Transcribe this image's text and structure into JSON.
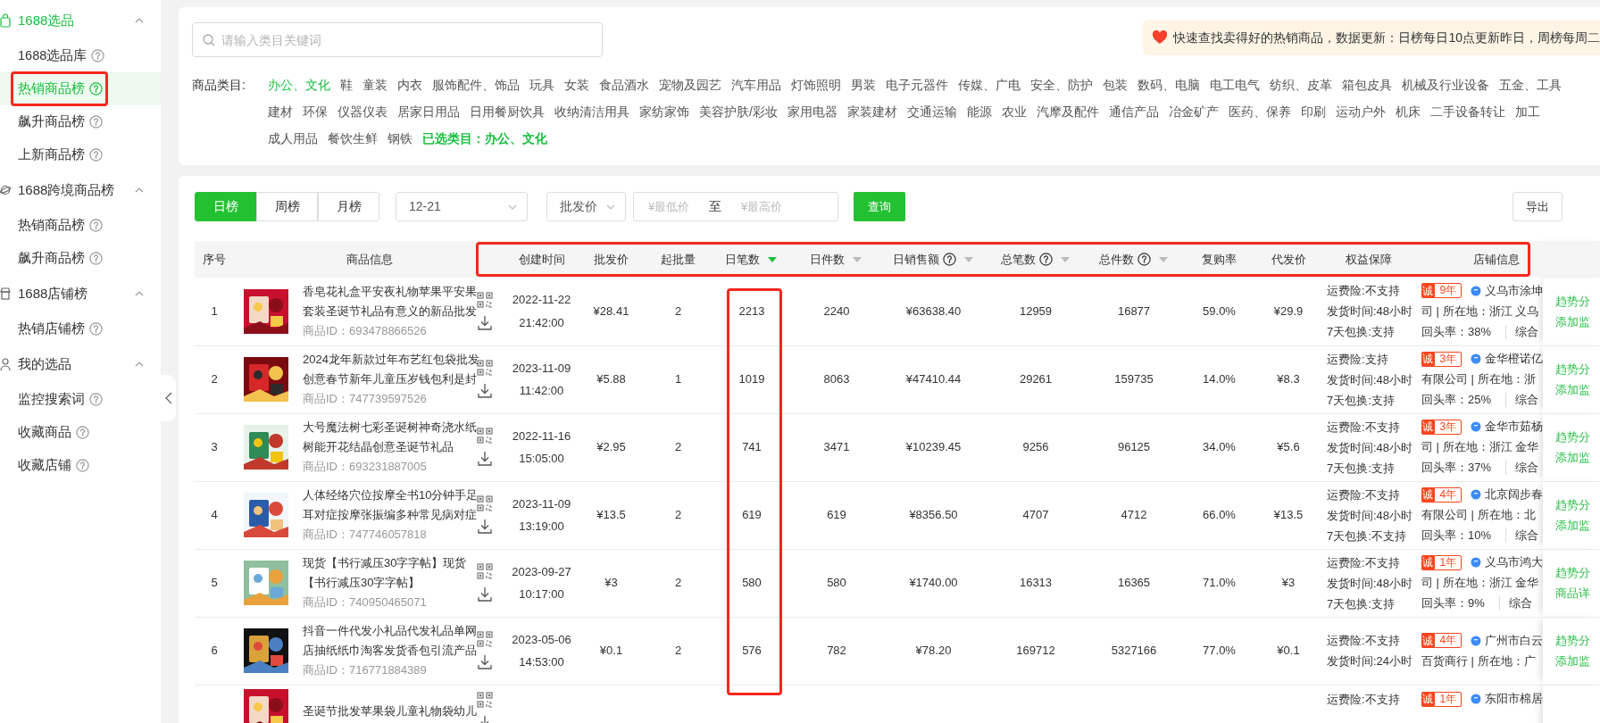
{
  "sidebar": {
    "groups": [
      {
        "title": "1688选品",
        "expanded": true,
        "items": [
          {
            "label": "1688选品库",
            "selected": false,
            "outlined": false
          },
          {
            "label": "热销商品榜",
            "selected": true,
            "outlined": true
          },
          {
            "label": "飙升商品榜",
            "selected": false,
            "outlined": false
          },
          {
            "label": "上新商品榜",
            "selected": false,
            "outlined": false
          }
        ]
      },
      {
        "title": "1688跨境商品榜",
        "expanded": true,
        "items": [
          {
            "label": "热销商品榜",
            "selected": false,
            "outlined": false
          },
          {
            "label": "飙升商品榜",
            "selected": false,
            "outlined": false
          }
        ]
      },
      {
        "title": "1688店铺榜",
        "expanded": true,
        "items": [
          {
            "label": "热销店铺榜",
            "selected": false,
            "outlined": false
          }
        ]
      },
      {
        "title": "我的选品",
        "expanded": true,
        "items": [
          {
            "label": "监控搜索词",
            "selected": false,
            "outlined": false
          },
          {
            "label": "收藏商品",
            "selected": false,
            "outlined": false
          },
          {
            "label": "收藏店铺",
            "selected": false,
            "outlined": false
          }
        ]
      }
    ]
  },
  "filters": {
    "search": {
      "placeholder": "请输入类目关键词"
    },
    "notice": "快速查找卖得好的热销商品，数据更新：日榜每日10点更新昨日，周榜每周二",
    "category_label": "商品类目:",
    "category_rows": [
      [
        {
          "label": "办公、文化",
          "selected": true
        },
        {
          "label": "鞋",
          "selected": false
        },
        {
          "label": "童装",
          "selected": false
        },
        {
          "label": "内衣",
          "selected": false
        },
        {
          "label": "服饰配件、饰品",
          "selected": false
        },
        {
          "label": "玩具",
          "selected": false
        },
        {
          "label": "女装",
          "selected": false
        },
        {
          "label": "食品酒水",
          "selected": false
        },
        {
          "label": "宠物及园艺",
          "selected": false
        },
        {
          "label": "汽车用品",
          "selected": false
        },
        {
          "label": "灯饰照明",
          "selected": false
        },
        {
          "label": "男装",
          "selected": false
        },
        {
          "label": "电子元器件",
          "selected": false
        },
        {
          "label": "传媒、广电",
          "selected": false
        },
        {
          "label": "安全、防护",
          "selected": false
        },
        {
          "label": "包装",
          "selected": false
        },
        {
          "label": "数码、电脑",
          "selected": false
        },
        {
          "label": "电工电气",
          "selected": false
        },
        {
          "label": "纺织、皮革",
          "selected": false
        },
        {
          "label": "箱包皮具",
          "selected": false
        },
        {
          "label": "机械及行业设备",
          "selected": false
        },
        {
          "label": "五金、工具",
          "selected": false
        }
      ],
      [
        {
          "label": "建材",
          "selected": false
        },
        {
          "label": "环保",
          "selected": false
        },
        {
          "label": "仪器仪表",
          "selected": false
        },
        {
          "label": "居家日用品",
          "selected": false
        },
        {
          "label": "日用餐厨饮具",
          "selected": false
        },
        {
          "label": "收纳清洁用具",
          "selected": false
        },
        {
          "label": "家纺家饰",
          "selected": false
        },
        {
          "label": "美容护肤/彩妆",
          "selected": false
        },
        {
          "label": "家用电器",
          "selected": false
        },
        {
          "label": "家装建材",
          "selected": false
        },
        {
          "label": "交通运输",
          "selected": false
        },
        {
          "label": "能源",
          "selected": false
        },
        {
          "label": "农业",
          "selected": false
        },
        {
          "label": "汽摩及配件",
          "selected": false
        },
        {
          "label": "通信产品",
          "selected": false
        },
        {
          "label": "冶金矿产",
          "selected": false
        },
        {
          "label": "医药、保养",
          "selected": false
        },
        {
          "label": "印刷",
          "selected": false
        },
        {
          "label": "运动户外",
          "selected": false
        },
        {
          "label": "机床",
          "selected": false
        },
        {
          "label": "二手设备转让",
          "selected": false
        },
        {
          "label": "加工",
          "selected": false
        }
      ],
      [
        {
          "label": "成人用品",
          "selected": false
        },
        {
          "label": "餐饮生鲜",
          "selected": false
        },
        {
          "label": "钢铁",
          "selected": false
        }
      ]
    ],
    "selected_summary": "已选类目：办公、文化"
  },
  "toolbar": {
    "periods": [
      {
        "label": "日榜",
        "selected": true
      },
      {
        "label": "周榜",
        "selected": false
      },
      {
        "label": "月榜",
        "selected": false
      }
    ],
    "date": "12-21",
    "price_type": "批发价",
    "min_price": {
      "placeholder": "¥最低价"
    },
    "range_sep": "至",
    "max_price": {
      "placeholder": "¥最高价"
    },
    "query": "查询",
    "export": "导出"
  },
  "table": {
    "columns": [
      {
        "label": "序号",
        "kind": "plain",
        "outlined": false,
        "column_outlined": false
      },
      {
        "label": "商品信息",
        "kind": "plain",
        "outlined": false,
        "column_outlined": false
      },
      {
        "label": "创建时间",
        "kind": "plain",
        "outlined": true,
        "column_outlined": false
      },
      {
        "label": "批发价",
        "kind": "plain",
        "outlined": true,
        "column_outlined": false
      },
      {
        "label": "起批量",
        "kind": "plain",
        "outlined": true,
        "column_outlined": false
      },
      {
        "label": "日笔数",
        "kind": "sorted",
        "outlined": true,
        "column_outlined": true
      },
      {
        "label": "日件数",
        "kind": "sortable",
        "outlined": true,
        "column_outlined": false
      },
      {
        "label": "日销售额",
        "kind": "sortable-help",
        "outlined": true,
        "column_outlined": false
      },
      {
        "label": "总笔数",
        "kind": "sortable-help",
        "outlined": true,
        "column_outlined": false
      },
      {
        "label": "总件数",
        "kind": "sortable-help",
        "outlined": true,
        "column_outlined": false
      },
      {
        "label": "复购率",
        "kind": "plain",
        "outlined": true,
        "column_outlined": false
      },
      {
        "label": "代发价",
        "kind": "plain",
        "outlined": true,
        "column_outlined": false
      },
      {
        "label": "权益保障",
        "kind": "plain",
        "outlined": true,
        "column_outlined": false
      },
      {
        "label": "店铺信息",
        "kind": "plain",
        "outlined": true,
        "column_outlined": false
      }
    ],
    "rows": [
      {
        "rank": "1",
        "title_lines": [
          "香皂花礼盒平安夜礼物苹果平安果",
          "套装圣诞节礼品有意义的新品批发"
        ],
        "product_id": "商品ID：693478866526",
        "date": "2022-11-22",
        "time": "21:42:00",
        "price": "¥28.41",
        "min_batch": "2",
        "daily_orders": "2213",
        "daily_pieces": "2240",
        "daily_sales": "¥63638.40",
        "total_orders": "12959",
        "total_pieces": "16877",
        "repurchase": "59.0%",
        "dropship_price": "¥29.9",
        "guarantees": [
          "运费险:不支持",
          "发货时间:48小时",
          "7天包换:支持"
        ],
        "store": {
          "badge": "诚",
          "years": "9年",
          "name": "义乌市涂坤",
          "line2": "司 | 所在地：浙江 义乌",
          "rate": "回头率：38%",
          "extra": "综合"
        },
        "actions": [
          "趋势分",
          "添加监"
        ]
      },
      {
        "rank": "2",
        "title_lines": [
          "2024龙年新款过年布艺红包袋批发",
          "创意春节新年儿童压岁钱包利是封"
        ],
        "product_id": "商品ID：747739597526",
        "date": "2023-11-09",
        "time": "11:42:00",
        "price": "¥5.88",
        "min_batch": "1",
        "daily_orders": "1019",
        "daily_pieces": "8063",
        "daily_sales": "¥47410.44",
        "total_orders": "29261",
        "total_pieces": "159735",
        "repurchase": "14.0%",
        "dropship_price": "¥8.3",
        "guarantees": [
          "运费险:支持",
          "发货时间:48小时",
          "7天包换:支持"
        ],
        "store": {
          "badge": "诚",
          "years": "3年",
          "name": "金华橙诺亿",
          "line2": "有限公司 | 所在地：浙",
          "rate": "回头率：25%",
          "extra": "综合"
        },
        "actions": [
          "趋势分",
          "添加监"
        ]
      },
      {
        "rank": "3",
        "title_lines": [
          "大号魔法树七彩圣诞树神奇浇水纸",
          "树能开花结晶创意圣诞节礼品"
        ],
        "product_id": "商品ID：693231887005",
        "date": "2022-11-16",
        "time": "15:05:00",
        "price": "¥2.95",
        "min_batch": "2",
        "daily_orders": "741",
        "daily_pieces": "3471",
        "daily_sales": "¥10239.45",
        "total_orders": "9256",
        "total_pieces": "96125",
        "repurchase": "34.0%",
        "dropship_price": "¥5.6",
        "guarantees": [
          "运费险:不支持",
          "发货时间:48小时",
          "7天包换:支持"
        ],
        "store": {
          "badge": "诚",
          "years": "3年",
          "name": "金华市茹杨",
          "line2": "司 | 所在地：浙江 金华",
          "rate": "回头率：37%",
          "extra": "综合"
        },
        "actions": [
          "趋势分",
          "添加监"
        ]
      },
      {
        "rank": "4",
        "title_lines": [
          "人体经络穴位按摩全书10分钟手足",
          "耳对症按摩张振编多种常见病对症"
        ],
        "product_id": "商品ID：747746057818",
        "date": "2023-11-09",
        "time": "13:19:00",
        "price": "¥13.5",
        "min_batch": "2",
        "daily_orders": "619",
        "daily_pieces": "619",
        "daily_sales": "¥8356.50",
        "total_orders": "4707",
        "total_pieces": "4712",
        "repurchase": "66.0%",
        "dropship_price": "¥13.5",
        "guarantees": [
          "运费险:不支持",
          "发货时间:48小时",
          "7天包换:不支持"
        ],
        "store": {
          "badge": "诚",
          "years": "4年",
          "name": "北京阔步春",
          "line2": "有限公司 | 所在地：北",
          "rate": "回头率：10%",
          "extra": "综合"
        },
        "actions": [
          "趋势分",
          "添加监"
        ]
      },
      {
        "rank": "5",
        "title_lines": [
          "现货【书行减压30字字帖】现货",
          "【书行减压30字字帖】"
        ],
        "product_id": "商品ID：740950465071",
        "date": "2023-09-27",
        "time": "10:17:00",
        "price": "¥3",
        "min_batch": "2",
        "daily_orders": "580",
        "daily_pieces": "580",
        "daily_sales": "¥1740.00",
        "total_orders": "16313",
        "total_pieces": "16365",
        "repurchase": "71.0%",
        "dropship_price": "¥3",
        "guarantees": [
          "运费险:不支持",
          "发货时间:48小时",
          "7天包换:支持"
        ],
        "store": {
          "badge": "诚",
          "years": "1年",
          "name": "义乌市鸿大",
          "line2": "司 | 所在地：浙江 金华",
          "rate": "回头率：9%",
          "extra": "综合"
        },
        "actions": [
          "趋势分",
          "商品详"
        ]
      },
      {
        "rank": "6",
        "title_lines": [
          "抖音一件代发小礼品代发礼品单网",
          "店抽纸纸巾淘客发货香包引流产品"
        ],
        "product_id": "商品ID：716771884389",
        "date": "2023-05-06",
        "time": "14:53:00",
        "price": "¥0.1",
        "min_batch": "2",
        "daily_orders": "576",
        "daily_pieces": "782",
        "daily_sales": "¥78.20",
        "total_orders": "169712",
        "total_pieces": "5327166",
        "repurchase": "77.0%",
        "dropship_price": "¥0.1",
        "guarantees": [
          "运费险:不支持",
          "发货时间:24小时"
        ],
        "store": {
          "badge": "诚",
          "years": "4年",
          "name": "广州市白云",
          "line2": "百货商行 | 所在地：广"
        },
        "actions": [
          "趋势分",
          "添加监"
        ]
      },
      {
        "title_lines": [
          "圣诞节批发苹果袋儿童礼物袋幼儿"
        ],
        "guarantees": [
          "运费险:不支持"
        ],
        "store": {
          "badge": "诚",
          "years": "1年",
          "name": "东阳市棉居"
        }
      }
    ]
  }
}
